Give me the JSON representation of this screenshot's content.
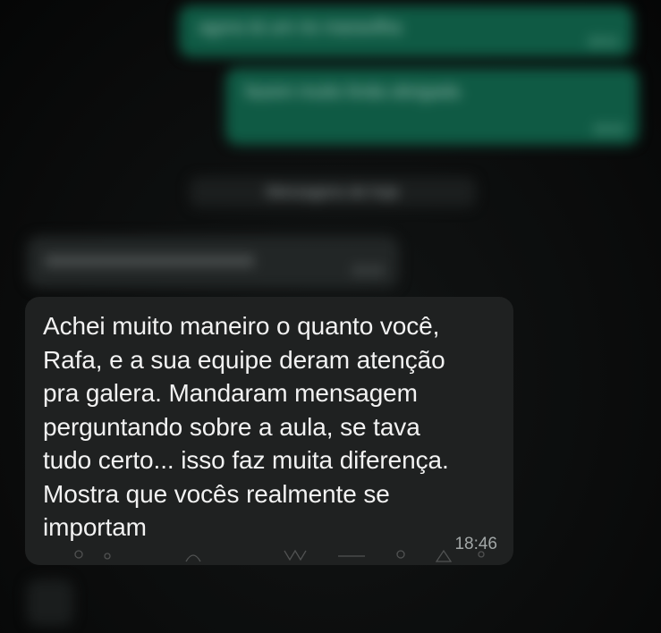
{
  "blurred": {
    "out_messages": [
      {
        "text": "agora tá um rio maravilha",
        "time": "18:41"
      },
      {
        "text": "fazem muito linda obrigada",
        "time": "18:42"
      }
    ],
    "day_label": "Mensagens de hoje",
    "in_message": {
      "text": "aaaaaaaaaaaaaaaaaaaaa",
      "time": "18:44"
    }
  },
  "message": {
    "lines": [
      "Achei muito maneiro o quanto você,",
      "Rafa, e a sua equipe deram atenção",
      "pra galera. Mandaram mensagem",
      "perguntando sobre a aula, se tava",
      "tudo certo... isso faz muita diferença.",
      "Mostra que vocês realmente se",
      "importam"
    ],
    "time": "18:46"
  },
  "colors": {
    "outgoing_bubble": "#0f5a44",
    "incoming_bubble": "#1f2121",
    "background": "#0a0c0c"
  }
}
